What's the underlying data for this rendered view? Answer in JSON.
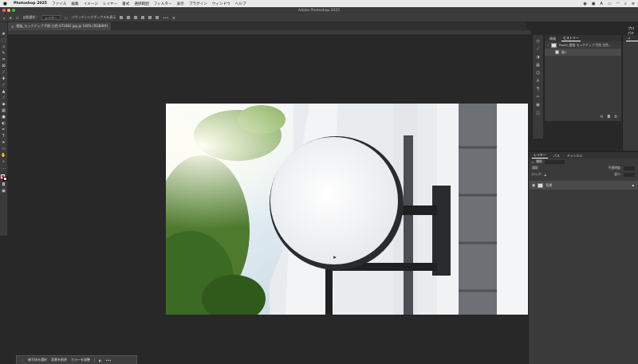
{
  "menubar": {
    "app": "Photoshop 2025",
    "items": [
      "ファイル",
      "編集",
      "イメージ",
      "レイヤー",
      "書式",
      "選択範囲",
      "フィルター",
      "表示",
      "プラグイン",
      "ウィンドウ",
      "ヘルプ"
    ]
  },
  "titlebar": {
    "title": "Adobe Photoshop 2025"
  },
  "options": {
    "auto_select": "自動選択 :",
    "layer_select": "レイヤー",
    "bbox_label": "バウンディングボックスを表示"
  },
  "document": {
    "tab_label": "看板_モックアップ 円形 白色 871682.jpg @ 100% (RGB/8#)"
  },
  "history_panel": {
    "tabs": [
      "情報",
      "ヒストリー"
    ],
    "items": [
      {
        "label": "Pixefy_看板 モックアップ 円形 白色..."
      },
      {
        "label": "開く"
      }
    ]
  },
  "props_panel": {
    "tab": "プロパティ"
  },
  "layers_panel": {
    "tabs": [
      "レイヤー",
      "パス",
      "チャンネル"
    ],
    "search_label": "種類",
    "blend_mode": "通常",
    "opacity_label": "不透明度:",
    "lock_label": "ロック:",
    "fill_label": "塗り:",
    "layer": {
      "name": "背景"
    }
  },
  "context_bar": {
    "items": [
      "被写体を選択",
      "背景を削除",
      "カラーを調整"
    ]
  },
  "colors": {
    "foreground": "#e31212",
    "background": "#ffffff"
  }
}
